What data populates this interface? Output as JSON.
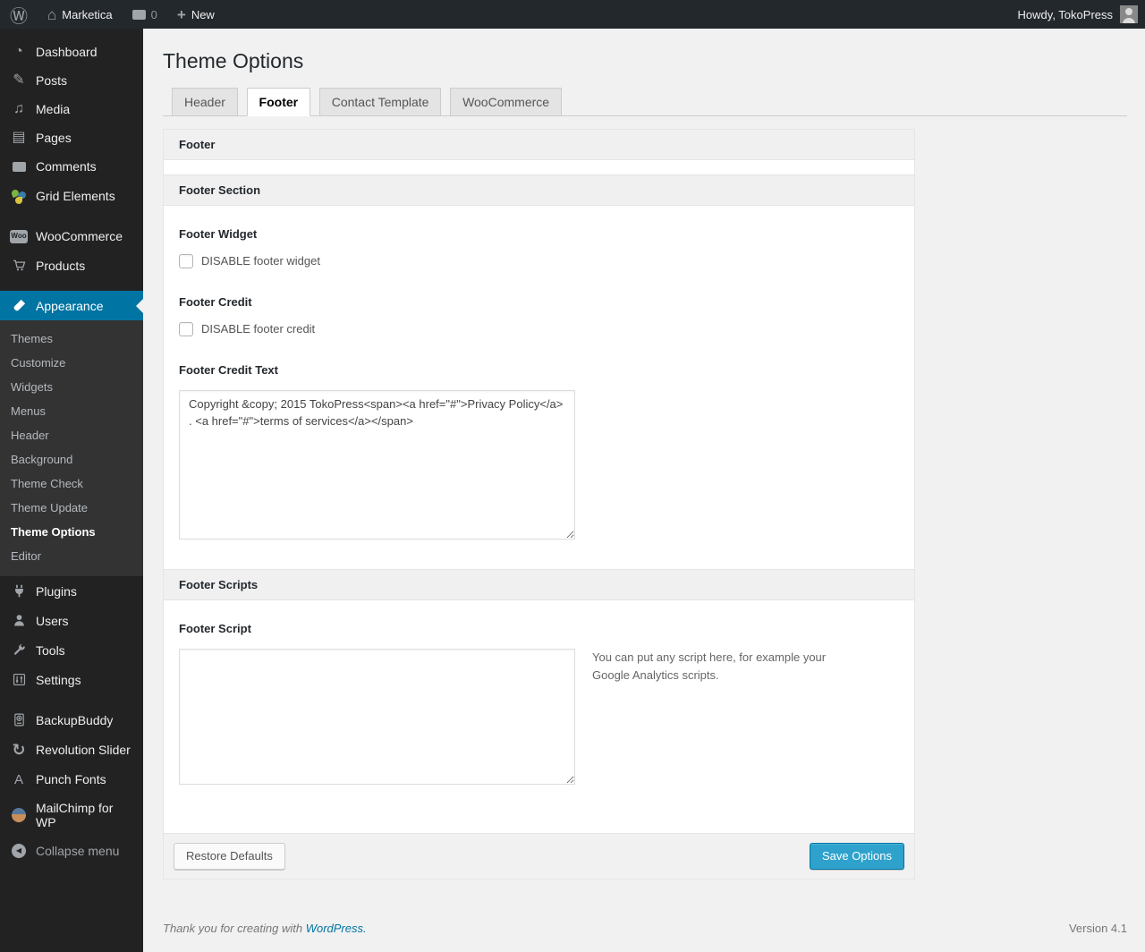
{
  "colors": {
    "accent": "#0074a2",
    "primary_button": "#2ea2cc",
    "admin_bar_bg": "#23282d",
    "sidebar_bg": "#222222"
  },
  "icons": {
    "wp_logo": "Ⓦ",
    "home": "⌂",
    "plus": "+",
    "dashboard": "◔",
    "posts": "✎",
    "media": "♫",
    "pages": "▤",
    "revolution_slider": "↻",
    "punch_fonts": "A",
    "collapse_arrow": "◀",
    "woo_badge_text": "Woo"
  },
  "admin_bar": {
    "site_name": "Marketica",
    "comments_count": "0",
    "new_label": "New",
    "howdy": "Howdy, TokoPress"
  },
  "sidebar": {
    "items": [
      {
        "label": "Dashboard"
      },
      {
        "label": "Posts"
      },
      {
        "label": "Media"
      },
      {
        "label": "Pages"
      },
      {
        "label": "Comments"
      },
      {
        "label": "Grid Elements"
      },
      {
        "label": "WooCommerce"
      },
      {
        "label": "Products"
      },
      {
        "label": "Appearance",
        "current": true
      },
      {
        "label": "Plugins"
      },
      {
        "label": "Users"
      },
      {
        "label": "Tools"
      },
      {
        "label": "Settings"
      },
      {
        "label": "BackupBuddy"
      },
      {
        "label": "Revolution Slider"
      },
      {
        "label": "Punch Fonts"
      },
      {
        "label": "MailChimp for WP"
      },
      {
        "label": "Collapse menu"
      }
    ],
    "appearance_submenu": [
      {
        "label": "Themes"
      },
      {
        "label": "Customize"
      },
      {
        "label": "Widgets"
      },
      {
        "label": "Menus"
      },
      {
        "label": "Header"
      },
      {
        "label": "Background"
      },
      {
        "label": "Theme Check"
      },
      {
        "label": "Theme Update"
      },
      {
        "label": "Theme Options",
        "current": true
      },
      {
        "label": "Editor"
      }
    ]
  },
  "page": {
    "title": "Theme Options",
    "tabs": [
      {
        "label": "Header",
        "active": false
      },
      {
        "label": "Footer",
        "active": true
      },
      {
        "label": "Contact Template",
        "active": false
      },
      {
        "label": "WooCommerce",
        "active": false
      }
    ]
  },
  "panel": {
    "box_title": "Footer",
    "section_title": "Footer Section",
    "fields": {
      "footer_widget": {
        "label": "Footer Widget",
        "checkbox_label": "DISABLE footer widget",
        "checked": false
      },
      "footer_credit": {
        "label": "Footer Credit",
        "checkbox_label": "DISABLE footer credit",
        "checked": false
      },
      "footer_credit_text": {
        "label": "Footer Credit Text",
        "value": "Copyright &copy; 2015 TokoPress<span><a href=\"#\">Privacy Policy</a> . <a href=\"#\">terms of services</a></span>"
      }
    },
    "scripts_section_title": "Footer Scripts",
    "footer_script": {
      "label": "Footer Script",
      "value": "",
      "note": "You can put any script here, for example your Google Analytics scripts."
    },
    "actions": {
      "restore": "Restore Defaults",
      "save": "Save Options"
    }
  },
  "page_footer": {
    "thanks_prefix": "Thank you for creating with ",
    "wordpress_link": "WordPress.",
    "version": "Version 4.1"
  }
}
